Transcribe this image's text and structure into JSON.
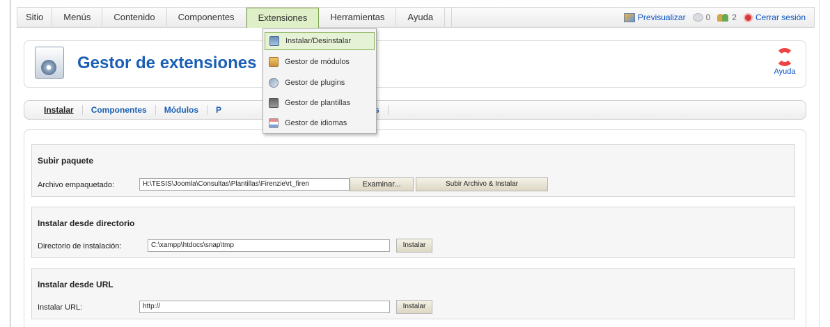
{
  "menu": {
    "items": [
      {
        "label": "Sitio"
      },
      {
        "label": "Menús"
      },
      {
        "label": "Contenido"
      },
      {
        "label": "Componentes"
      },
      {
        "label": "Extensiones",
        "active": true
      },
      {
        "label": "Herramientas"
      },
      {
        "label": "Ayuda"
      }
    ]
  },
  "status": {
    "preview_label": "Previsualizar",
    "messages_count": "0",
    "users_count": "2",
    "logout_label": "Cerrar sesión"
  },
  "dropdown": {
    "items": [
      {
        "label": "Instalar/Desinstalar",
        "icon": "install-icon",
        "selected": true
      },
      {
        "label": "Gestor de módulos",
        "icon": "module-icon"
      },
      {
        "label": "Gestor de plugins",
        "icon": "plugin-icon"
      },
      {
        "label": "Gestor de plantillas",
        "icon": "template-icon"
      },
      {
        "label": "Gestor de idiomas",
        "icon": "language-icon"
      }
    ]
  },
  "header": {
    "title": "Gestor de extensiones",
    "help_label": "Ayuda"
  },
  "tabs": [
    {
      "label": "Instalar",
      "current": true
    },
    {
      "label": "Componentes"
    },
    {
      "label": "Módulos"
    },
    {
      "label": "P"
    },
    {
      "label": "Plantillas"
    }
  ],
  "upload": {
    "title": "Subir paquete",
    "label": "Archivo empaquetado:",
    "value": "H:\\TESIS\\Joomla\\Consultas\\Plantillas\\Firenzie\\rt_firen",
    "browse_label": "Examinar...",
    "submit_label": "Subir Archivo & Instalar"
  },
  "directory": {
    "title": "Instalar desde directorio",
    "label": "Directorio de instalación:",
    "value": "C:\\xampp\\htdocs\\snap\\tmp",
    "button_label": "Instalar"
  },
  "url": {
    "title": "Instalar desde URL",
    "label": "Instalar URL:",
    "value": "http://",
    "button_label": "Instalar"
  }
}
